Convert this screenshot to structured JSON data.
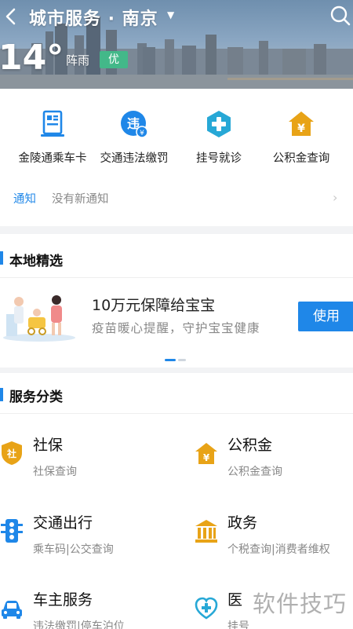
{
  "header": {
    "title": "城市服务 · 南京",
    "temperature": "14°",
    "weather": "阵雨",
    "aqi": "优"
  },
  "quick_services": [
    {
      "label": "金陵通乘车卡",
      "icon": "card-reader-icon"
    },
    {
      "label": "交通违法缴罚",
      "icon": "traffic-fine-icon"
    },
    {
      "label": "挂号就诊",
      "icon": "medical-cross-icon"
    },
    {
      "label": "公积金查询",
      "icon": "house-yuan-icon"
    }
  ],
  "notice": {
    "tag": "通知",
    "text": "没有新通知"
  },
  "local_picks": {
    "title": "本地精选",
    "promo_title": "10万元保障给宝宝",
    "promo_subtitle": "疫苗暖心提醒，守护宝宝健康",
    "button": "使用"
  },
  "categories": {
    "title": "服务分类",
    "items": [
      {
        "name": "社保",
        "desc": "社保查询",
        "icon": "social-security-icon"
      },
      {
        "name": "公积金",
        "desc": "公积金查询",
        "icon": "housing-fund-icon"
      },
      {
        "name": "交通出行",
        "desc": "乘车码|公交查询",
        "icon": "traffic-light-icon"
      },
      {
        "name": "政务",
        "desc": "个税查询|消费者维权",
        "icon": "government-building-icon"
      },
      {
        "name": "车主服务",
        "desc": "违法缴罚|停车泊位",
        "icon": "car-icon"
      },
      {
        "name": "医",
        "desc": "挂号",
        "icon": "medical-heart-icon"
      }
    ]
  },
  "watermark": "软件技巧",
  "colors": {
    "accent": "#1f87e8",
    "aqi_good": "#43b889",
    "icon_orange": "#e8a317"
  }
}
